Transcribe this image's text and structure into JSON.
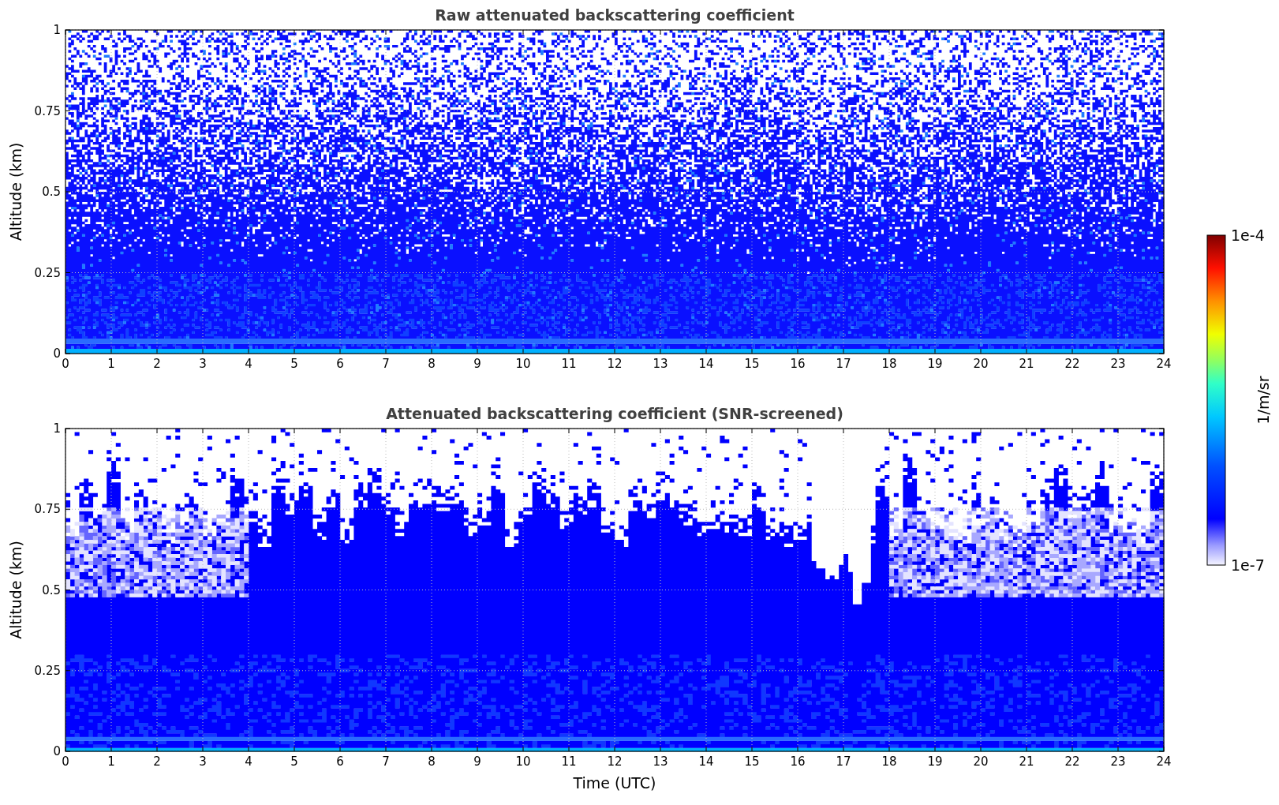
{
  "plots": [
    {
      "title": "Raw attenuated backscattering coefficient",
      "ylabel": "Altitude (km)",
      "yticks": [
        "1",
        "0.75",
        "0.5",
        "0.25",
        "0"
      ],
      "xticks": [
        "0",
        "1",
        "2",
        "3",
        "4",
        "5",
        "6",
        "7",
        "8",
        "9",
        "10",
        "11",
        "12",
        "13",
        "14",
        "15",
        "16",
        "17",
        "18",
        "19",
        "20",
        "21",
        "22",
        "23",
        "24"
      ]
    },
    {
      "title": "Attenuated backscattering coefficient (SNR-screened)",
      "ylabel": "Altitude (km)",
      "yticks": [
        "1",
        "0.75",
        "0.5",
        "0.25",
        "0"
      ],
      "xticks": [
        "0",
        "1",
        "2",
        "3",
        "4",
        "5",
        "6",
        "7",
        "8",
        "9",
        "10",
        "11",
        "12",
        "13",
        "14",
        "15",
        "16",
        "17",
        "18",
        "19",
        "20",
        "21",
        "22",
        "23",
        "24"
      ],
      "xlabel": "Time (UTC)"
    }
  ],
  "colorbar": {
    "max_label": "1e-4",
    "min_label": "1e-7",
    "label": "1/m/sr"
  }
}
